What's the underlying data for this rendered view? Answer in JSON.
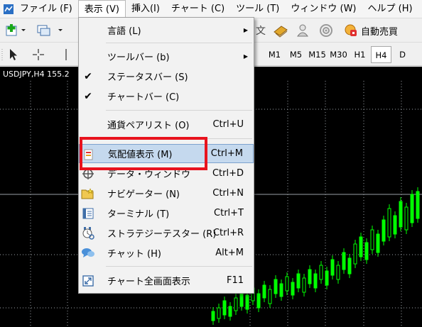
{
  "menubar": {
    "items": [
      "ファイル (F)",
      "表示 (V)",
      "挿入(I)",
      "チャート (C)",
      "ツール (T)",
      "ウィンドウ (W)",
      "ヘルプ (H)"
    ]
  },
  "toolbar": {
    "auto_trade_label": "自動売買",
    "periods": [
      "M1",
      "M5",
      "M15",
      "M30",
      "H1",
      "H4",
      "D"
    ],
    "active_period": "H4"
  },
  "chart": {
    "symbol_label": "USDJPY,H4  155.2"
  },
  "view_menu": {
    "items": [
      {
        "label": "言語 (L)",
        "shortcut": "",
        "submenu": true
      },
      {
        "label": "ツールバー (b)",
        "shortcut": "",
        "submenu": true
      },
      {
        "label": "ステータスバー (S)",
        "shortcut": "",
        "checked": true
      },
      {
        "label": "チャートバー (C)",
        "shortcut": "",
        "checked": true
      },
      {
        "label": "通貨ペアリスト (O)",
        "shortcut": "Ctrl+U"
      },
      {
        "label": "気配値表示 (M)",
        "shortcut": "Ctrl+M",
        "highlighted": true
      },
      {
        "label": "データ・ウィンドウ",
        "shortcut": "Ctrl+D"
      },
      {
        "label": "ナビゲーター (N)",
        "shortcut": "Ctrl+N"
      },
      {
        "label": "ターミナル (T)",
        "shortcut": "Ctrl+T"
      },
      {
        "label": "ストラテジーテスター (R)",
        "shortcut": "Ctrl+R"
      },
      {
        "label": "チャット (H)",
        "shortcut": "Alt+M"
      },
      {
        "label": "チャート全画面表示",
        "shortcut": "F11"
      }
    ]
  },
  "colors": {
    "highlight": "#c5d9ee",
    "callout": "#e8131e",
    "bull_candle": "#00ff00",
    "chart_bg": "#000000"
  }
}
